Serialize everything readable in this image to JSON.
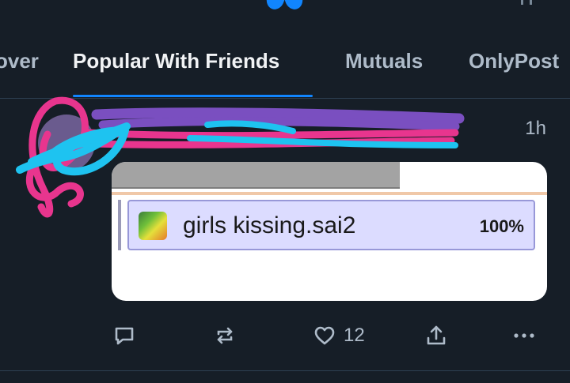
{
  "tabs": [
    {
      "label": "over"
    },
    {
      "label": "Popular With Friends"
    },
    {
      "label": "Mutuals"
    },
    {
      "label": "OnlyPost"
    }
  ],
  "post": {
    "timestamp": "1h",
    "embed": {
      "file_name": "girls kissing.sai2",
      "file_progress": "100%"
    },
    "actions": {
      "like_count": "12"
    }
  },
  "colors": {
    "background": "#161e27",
    "accent": "#1185fe",
    "muted_text": "#aebbc9",
    "scribble_pink": "#e8358e",
    "scribble_blue": "#1ec3f0",
    "scribble_purple": "#7a4fc0"
  },
  "icons": [
    "butterfly-logo-icon",
    "reply-icon",
    "repost-icon",
    "like-icon",
    "share-icon",
    "more-icon",
    "file-icon"
  ]
}
